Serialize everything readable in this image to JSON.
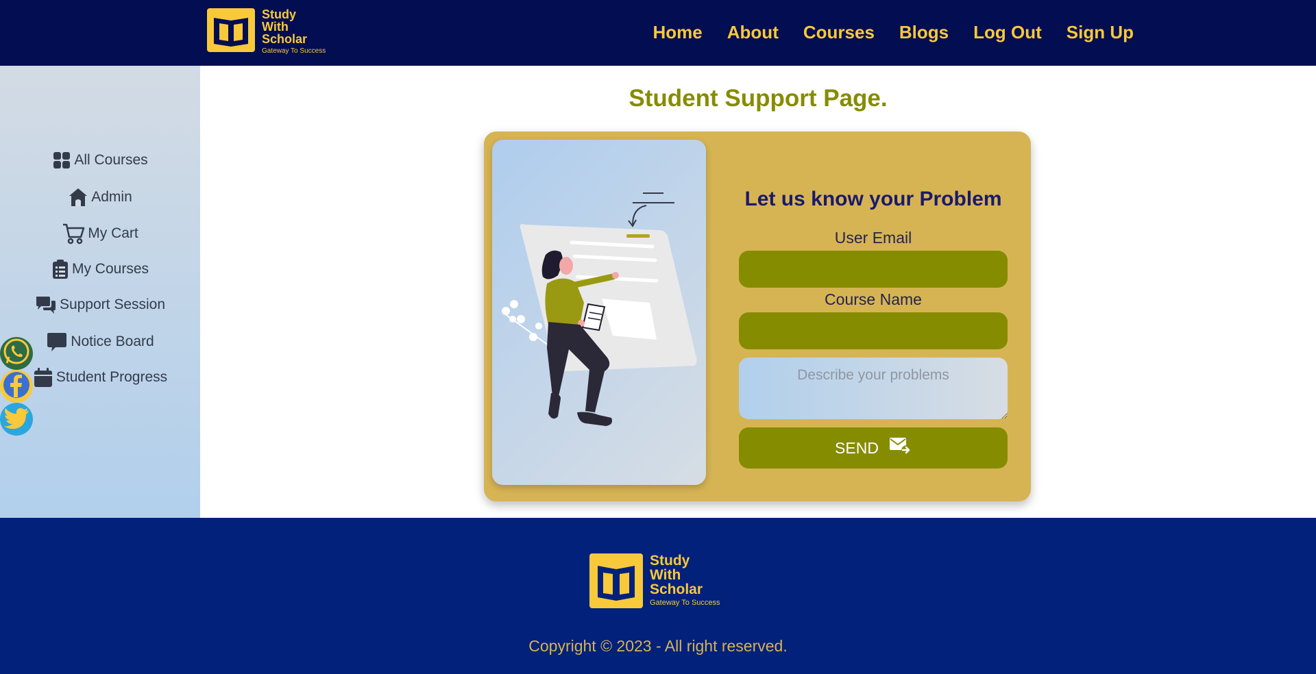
{
  "brand": {
    "name_line1": "Study",
    "name_line2": "With",
    "name_line3": "Scholar",
    "tagline": "Gateway To Success",
    "logo_icon": "open-book-icon"
  },
  "nav": {
    "links": [
      "Home",
      "About",
      "Courses",
      "Blogs",
      "Log Out",
      "Sign Up"
    ]
  },
  "sidebar": {
    "items": [
      {
        "label": "All Courses",
        "icon": "grid-icon"
      },
      {
        "label": "Admin",
        "icon": "home-icon"
      },
      {
        "label": "My Cart",
        "icon": "cart-icon"
      },
      {
        "label": "My Courses",
        "icon": "clipboard-icon"
      },
      {
        "label": "Support Session",
        "icon": "chat-icon"
      },
      {
        "label": "Notice Board",
        "icon": "message-icon"
      },
      {
        "label": "Student Progress",
        "icon": "calendar-icon"
      }
    ]
  },
  "social": {
    "items": [
      {
        "icon": "whatsapp-icon",
        "color": "#2f6b44"
      },
      {
        "icon": "facebook-icon",
        "color": "#f8c93a"
      },
      {
        "icon": "twitter-icon",
        "color": "#2aa7e0"
      }
    ]
  },
  "main": {
    "title": "Student Support Page."
  },
  "form": {
    "heading": "Let us know your Problem",
    "email_label": "User Email",
    "email_value": "",
    "course_label": "Course Name",
    "course_value": "",
    "problem_placeholder": "Describe your problems",
    "send_label": "SEND",
    "send_icon": "mail-send-icon"
  },
  "footer": {
    "copyright": "Copyright © 2023 - All right reserved."
  },
  "colors": {
    "header_bg": "#020d52",
    "footer_bg": "#01217b",
    "accent_yellow": "#f8c93a",
    "card_bg": "#d6b454",
    "olive": "#868c00"
  }
}
